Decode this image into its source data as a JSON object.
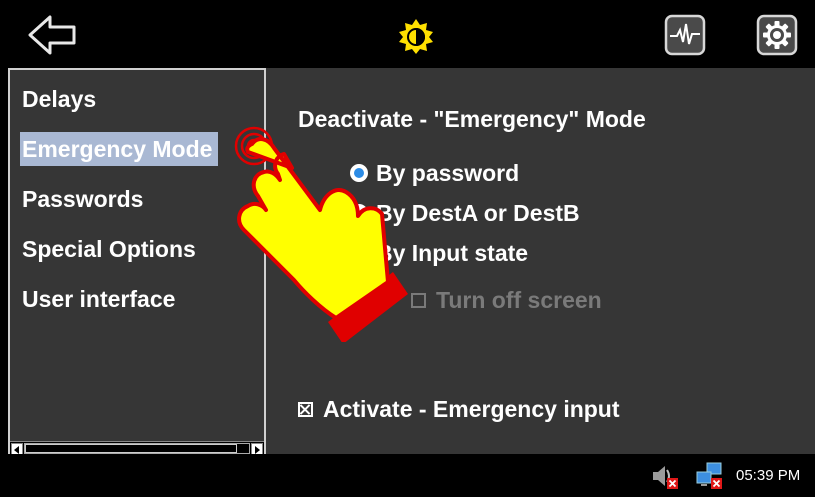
{
  "topbar": {
    "back_icon": "left-arrow-icon",
    "brightness_icon": "brightness-icon",
    "monitor_icon": "pulse-monitor-icon",
    "settings_icon": "gear-icon"
  },
  "sidebar": {
    "items": [
      {
        "label": "Delays",
        "selected": false
      },
      {
        "label": "Emergency Mode",
        "selected": true
      },
      {
        "label": "Passwords",
        "selected": false
      },
      {
        "label": "Special Options",
        "selected": false
      },
      {
        "label": "User interface",
        "selected": false
      }
    ]
  },
  "main": {
    "title": "Deactivate - \"Emergency\" Mode",
    "options": [
      {
        "label": "By password",
        "checked": true
      },
      {
        "label": "By DestA or DestB",
        "checked": false
      },
      {
        "label": "By Input state",
        "checked": false
      }
    ],
    "turn_off_screen": {
      "label": "Turn off screen",
      "checked": false,
      "disabled": true
    },
    "activate_input": {
      "label": "Activate - Emergency input",
      "checked": true
    }
  },
  "overlay": {
    "icon": "pointing-hand-icon"
  },
  "taskbar": {
    "volume_icon": "volume-muted-icon",
    "network_icon": "network-disconnected-icon",
    "clock": "05:39 PM"
  },
  "colors": {
    "panel_bg": "#363636",
    "selection_bg": "#a9b8d3",
    "radio_accent": "#2c8ce6",
    "brightness_yellow": "#ffe000",
    "hand_yellow": "#ffff00",
    "hand_red": "#e00000"
  }
}
